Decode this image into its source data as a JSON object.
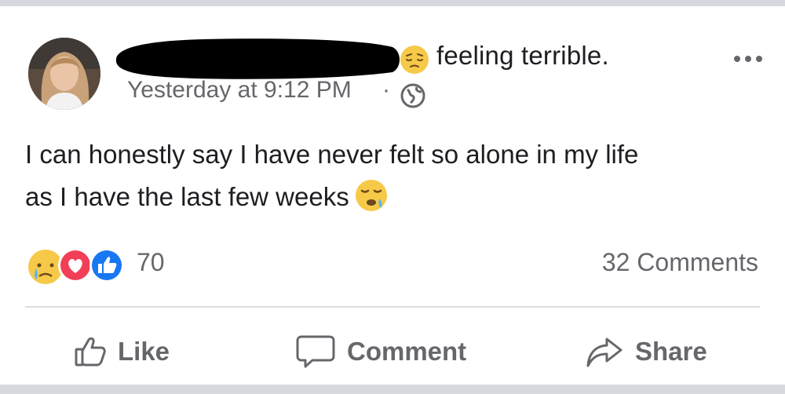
{
  "post": {
    "feeling": {
      "emoji": "pensive-face",
      "text": "feeling terrible."
    },
    "timestamp": "Yesterday at 9:12 PM",
    "separator": "·",
    "privacy_icon": "globe-icon",
    "body_lines": [
      "I can honestly say I have never felt so alone in my life",
      "as I have the last few weeks"
    ],
    "body_emoji": "sleepy-face",
    "reactions": {
      "icons": [
        "sad-reaction",
        "love-reaction",
        "like-reaction"
      ],
      "count": "70"
    },
    "comments_count": "32 Comments"
  },
  "actions": {
    "like_label": "Like",
    "comment_label": "Comment",
    "share_label": "Share"
  },
  "colors": {
    "text": "#1c1e21",
    "secondary": "#65676b",
    "like_blue": "#1877f2",
    "love_red": "#f33e58",
    "emoji_yellow": "#f7c948"
  }
}
